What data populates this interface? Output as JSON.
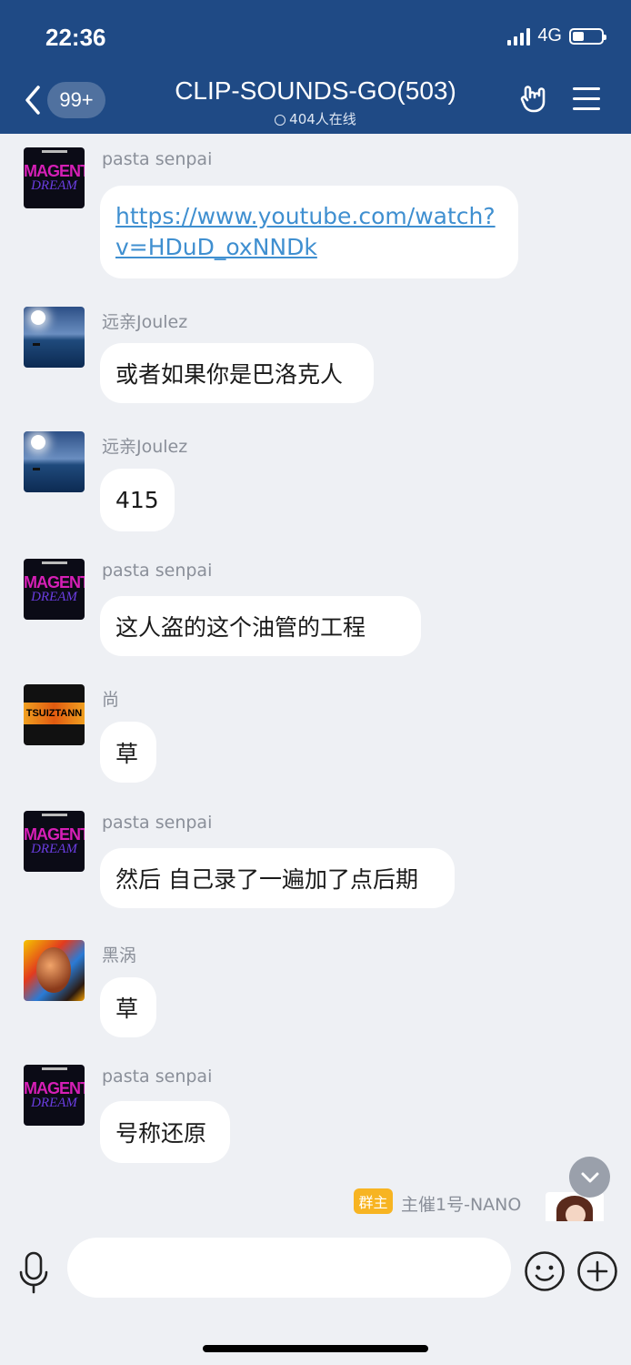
{
  "status_bar": {
    "time": "22:36",
    "network": "4G"
  },
  "header": {
    "unread_badge": "99+",
    "title": "CLIP-SOUNDS-GO(503)",
    "online_text": "404人在线"
  },
  "messages": [
    {
      "sender": "pasta senpai",
      "text": "https://www.youtube.com/watch?v=HDuD_oxNNDk",
      "text_line1": "https://www.youtube.com/watch?",
      "text_line2": "v=HDuD_oxNNDk",
      "avatar": "magenta-avatar",
      "avatar_text1": "MAGENTA",
      "avatar_text2": "DREAM"
    },
    {
      "sender": "远亲Joulez",
      "text": "或者如果你是巴洛克人",
      "avatar": "lake-avatar"
    },
    {
      "sender": "远亲Joulez",
      "text": "415",
      "avatar": "lake-avatar"
    },
    {
      "sender": "pasta senpai",
      "text": "这人盗的这个油管的工程",
      "avatar": "magenta-avatar",
      "avatar_text1": "MAGENTA",
      "avatar_text2": "DREAM"
    },
    {
      "sender": "尚",
      "text": "草",
      "avatar": "tsuiztann-avatar",
      "avatar_text1": "TSUIZTANN"
    },
    {
      "sender": "pasta senpai",
      "text": "然后 自己录了一遍加了点后期",
      "avatar": "magenta-avatar",
      "avatar_text1": "MAGENTA",
      "avatar_text2": "DREAM"
    },
    {
      "sender": "黑涡",
      "text": "草",
      "avatar": "portrait-avatar"
    },
    {
      "sender": "pasta senpai",
      "text": "号称还原",
      "avatar": "magenta-avatar",
      "avatar_text1": "MAGENTA",
      "avatar_text2": "DREAM"
    }
  ],
  "owner_message": {
    "badge": "群主",
    "sender": "主催1号-NANO"
  },
  "input": {
    "placeholder": ""
  },
  "colors": {
    "header_bg": "#1f4a85",
    "link": "#3f8fd0",
    "owner_badge": "#f7b422"
  }
}
